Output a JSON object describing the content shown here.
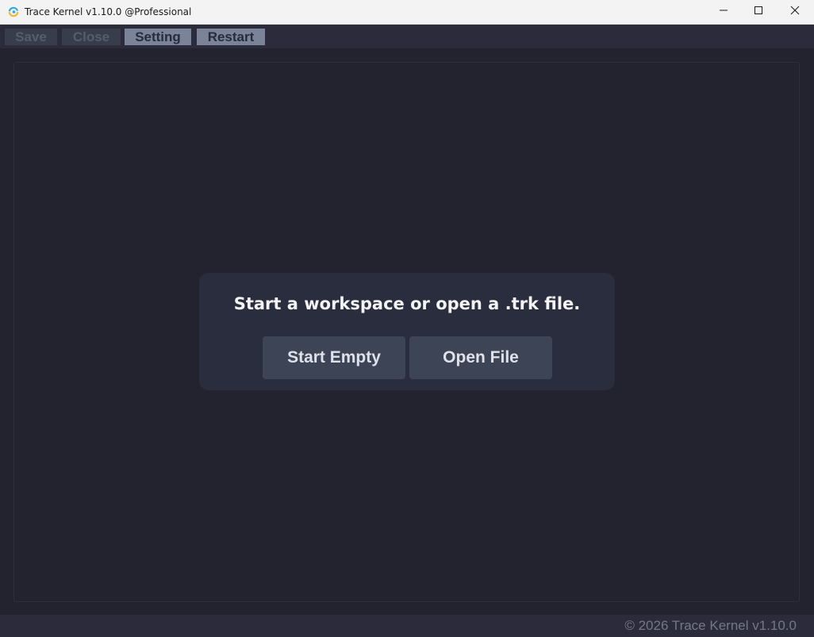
{
  "window": {
    "title": "Trace Kernel v1.10.0 @Professional"
  },
  "menu": {
    "save_label": "Save",
    "close_label": "Close",
    "setting_label": "Setting",
    "restart_label": "Restart"
  },
  "welcome": {
    "message": "Start a workspace or open a .trk file.",
    "start_empty_label": "Start Empty",
    "open_file_label": "Open File"
  },
  "footer": {
    "copyright": "© 2026 Trace Kernel v1.10.0"
  },
  "icons": {
    "app": "trace-kernel-logo-icon",
    "minimize": "minimize-icon",
    "maximize": "maximize-icon",
    "close": "close-icon"
  },
  "colors": {
    "background": "#23222f",
    "card": "#2a2d3d",
    "button": "#3d4456",
    "enabled_menu": "#7a8398",
    "disabled_menu": "#383d4b"
  }
}
